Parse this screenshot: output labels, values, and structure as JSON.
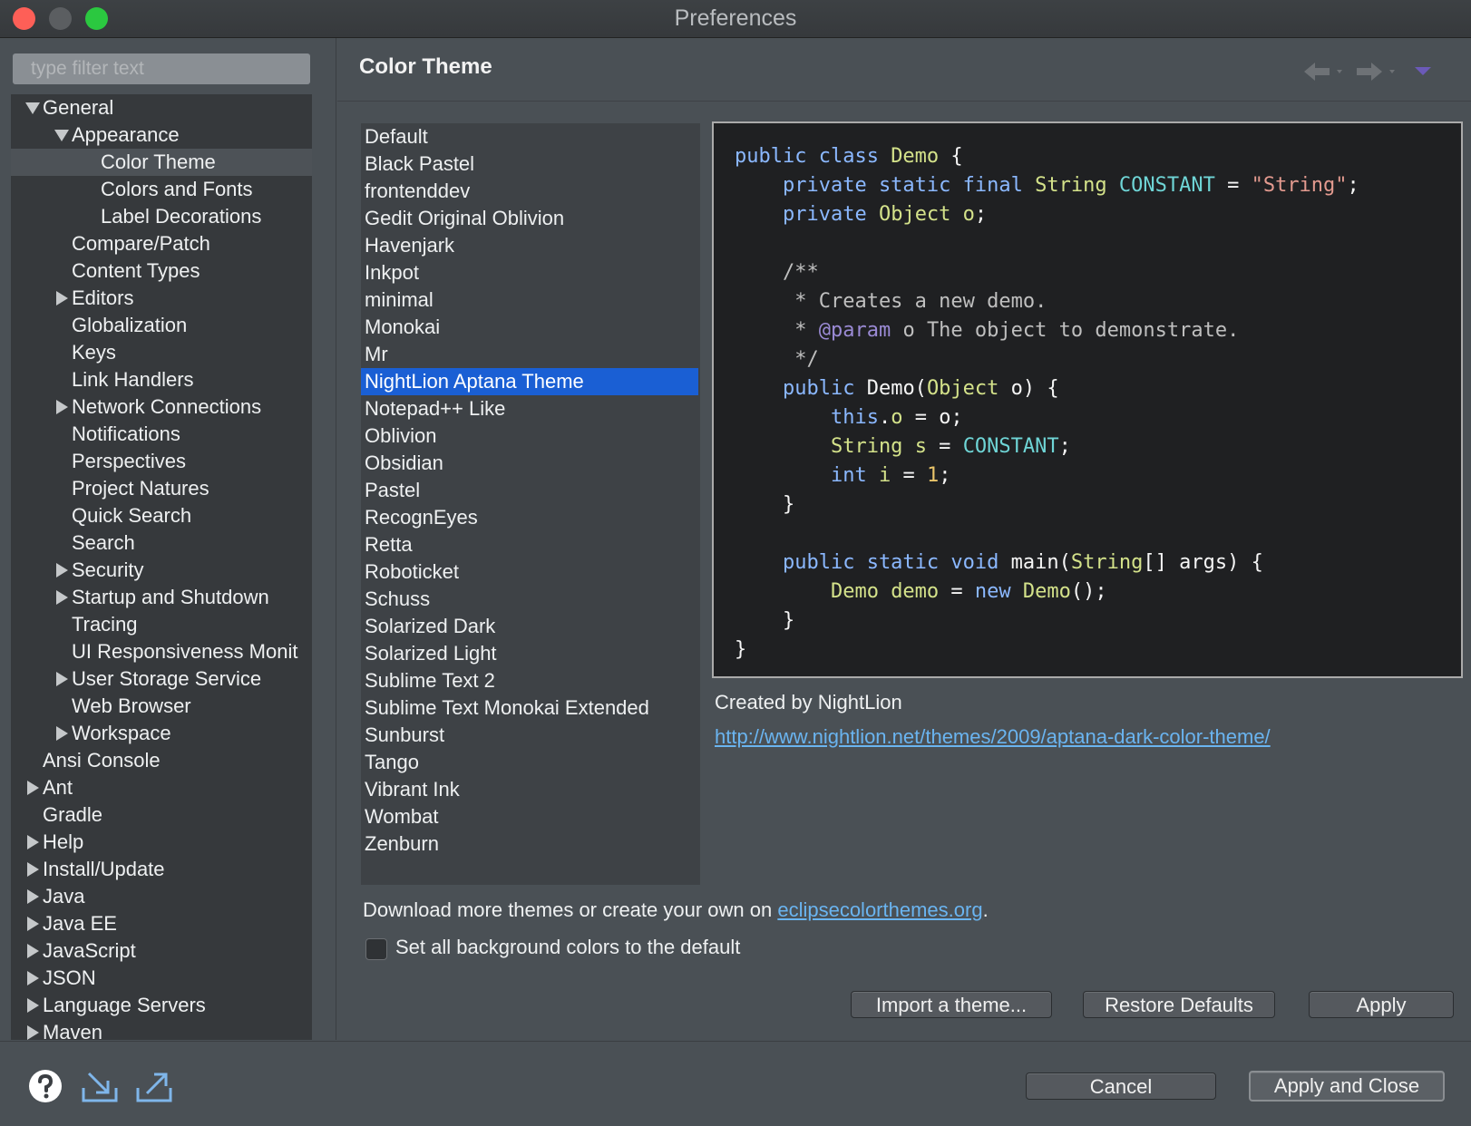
{
  "window": {
    "title": "Preferences"
  },
  "filter": {
    "placeholder": "type filter text"
  },
  "tree": [
    {
      "label": "General",
      "expander": "expanded"
    },
    {
      "label": "Appearance",
      "expander": "expanded"
    },
    {
      "label": "Color Theme",
      "expander": "none",
      "selected": true
    },
    {
      "label": "Colors and Fonts",
      "expander": "none"
    },
    {
      "label": "Label Decorations",
      "expander": "none"
    },
    {
      "label": "Compare/Patch",
      "expander": "none"
    },
    {
      "label": "Content Types",
      "expander": "none"
    },
    {
      "label": "Editors",
      "expander": "collapsed"
    },
    {
      "label": "Globalization",
      "expander": "none"
    },
    {
      "label": "Keys",
      "expander": "none"
    },
    {
      "label": "Link Handlers",
      "expander": "none"
    },
    {
      "label": "Network Connections",
      "expander": "collapsed"
    },
    {
      "label": "Notifications",
      "expander": "none"
    },
    {
      "label": "Perspectives",
      "expander": "none"
    },
    {
      "label": "Project Natures",
      "expander": "none"
    },
    {
      "label": "Quick Search",
      "expander": "none"
    },
    {
      "label": "Search",
      "expander": "none"
    },
    {
      "label": "Security",
      "expander": "collapsed"
    },
    {
      "label": "Startup and Shutdown",
      "expander": "collapsed"
    },
    {
      "label": "Tracing",
      "expander": "none"
    },
    {
      "label": "UI Responsiveness Monit",
      "expander": "none"
    },
    {
      "label": "User Storage Service",
      "expander": "collapsed"
    },
    {
      "label": "Web Browser",
      "expander": "none"
    },
    {
      "label": "Workspace",
      "expander": "collapsed"
    },
    {
      "label": "Ansi Console",
      "expander": "none"
    },
    {
      "label": "Ant",
      "expander": "collapsed"
    },
    {
      "label": "Gradle",
      "expander": "none"
    },
    {
      "label": "Help",
      "expander": "collapsed"
    },
    {
      "label": "Install/Update",
      "expander": "collapsed"
    },
    {
      "label": "Java",
      "expander": "collapsed"
    },
    {
      "label": "Java EE",
      "expander": "collapsed"
    },
    {
      "label": "JavaScript",
      "expander": "collapsed"
    },
    {
      "label": "JSON",
      "expander": "collapsed"
    },
    {
      "label": "Language Servers",
      "expander": "collapsed"
    },
    {
      "label": "Maven",
      "expander": "collapsed"
    }
  ],
  "page": {
    "title": "Color Theme"
  },
  "header_icons": [
    "back-arrow-icon",
    "forward-arrow-icon",
    "view-menu-icon"
  ],
  "themes": [
    "Default",
    "Black Pastel",
    "frontenddev",
    "Gedit Original Oblivion",
    "Havenjark",
    "Inkpot",
    "minimal",
    "Monokai",
    "Mr",
    "NightLion Aptana Theme",
    "Notepad++ Like",
    "Oblivion",
    "Obsidian",
    "Pastel",
    "RecognEyes",
    "Retta",
    "Roboticket",
    "Schuss",
    "Solarized Dark",
    "Solarized Light",
    "Sublime Text 2",
    "Sublime Text Monokai Extended",
    "Sunburst",
    "Tango",
    "Vibrant Ink",
    "Wombat",
    "Zenburn"
  ],
  "selected_theme": "NightLion Aptana Theme",
  "preview": {
    "code": [
      [
        [
          "public class ",
          "kw"
        ],
        [
          "Demo",
          "ty"
        ],
        [
          " {",
          ""
        ]
      ],
      [
        [
          "    private static final ",
          "kw"
        ],
        [
          "String ",
          "ty"
        ],
        [
          "CONSTANT",
          "cn"
        ],
        [
          " = ",
          ""
        ],
        [
          "\"String\"",
          "st"
        ],
        [
          ";",
          ""
        ]
      ],
      [
        [
          "    private ",
          "kw"
        ],
        [
          "Object ",
          "ty"
        ],
        [
          "o",
          "fl"
        ],
        [
          ";",
          ""
        ]
      ],
      [
        [
          "",
          ""
        ]
      ],
      [
        [
          "    /**",
          "cm"
        ]
      ],
      [
        [
          "     * Creates a new demo.",
          "cm"
        ]
      ],
      [
        [
          "     * ",
          "cm"
        ],
        [
          "@param",
          "an"
        ],
        [
          " o The object to demonstrate.",
          "cm"
        ]
      ],
      [
        [
          "     */",
          "cm"
        ]
      ],
      [
        [
          "    public ",
          "kw"
        ],
        [
          "Demo(",
          ""
        ],
        [
          "Object",
          "ty"
        ],
        [
          " o) {",
          ""
        ]
      ],
      [
        [
          "        this",
          "kw"
        ],
        [
          ".",
          ""
        ],
        [
          "o",
          "fl"
        ],
        [
          " = o;",
          ""
        ]
      ],
      [
        [
          "        String ",
          "ty"
        ],
        [
          "s",
          "fl"
        ],
        [
          " = ",
          ""
        ],
        [
          "CONSTANT",
          "cn"
        ],
        [
          ";",
          ""
        ]
      ],
      [
        [
          "        int ",
          "kw"
        ],
        [
          "i",
          "fl"
        ],
        [
          " = ",
          ""
        ],
        [
          "1",
          "nm"
        ],
        [
          ";",
          ""
        ]
      ],
      [
        [
          "    }",
          ""
        ]
      ],
      [
        [
          "",
          ""
        ]
      ],
      [
        [
          "    public static void ",
          "kw"
        ],
        [
          "main(",
          ""
        ],
        [
          "String",
          "ty"
        ],
        [
          "[] args) {",
          ""
        ]
      ],
      [
        [
          "        Demo ",
          "ty"
        ],
        [
          "demo",
          "fl"
        ],
        [
          " = ",
          ""
        ],
        [
          "new ",
          "kw"
        ],
        [
          "Demo",
          "ty"
        ],
        [
          "();",
          ""
        ]
      ],
      [
        [
          "    }",
          ""
        ]
      ],
      [
        [
          "}",
          ""
        ]
      ]
    ]
  },
  "info": {
    "created_by": "Created by NightLion",
    "url": "http://www.nightlion.net/themes/2009/aptana-dark-color-theme/"
  },
  "download": {
    "prefix": "Download more themes or create your own on ",
    "link": "eclipsecolorthemes.org",
    "suffix": "."
  },
  "checkbox": {
    "label": "Set all background colors to the default",
    "checked": false
  },
  "buttons": {
    "import": "Import a theme...",
    "restore": "Restore Defaults",
    "apply": "Apply",
    "cancel": "Cancel",
    "apply_close": "Apply and Close"
  },
  "footer_icons": [
    "help-icon",
    "import-preferences-icon",
    "export-preferences-icon"
  ],
  "colors": {
    "selection": "#1a5fd4",
    "link": "#6ab4f0",
    "close": "#fe5f57",
    "maximize": "#2bc840"
  }
}
